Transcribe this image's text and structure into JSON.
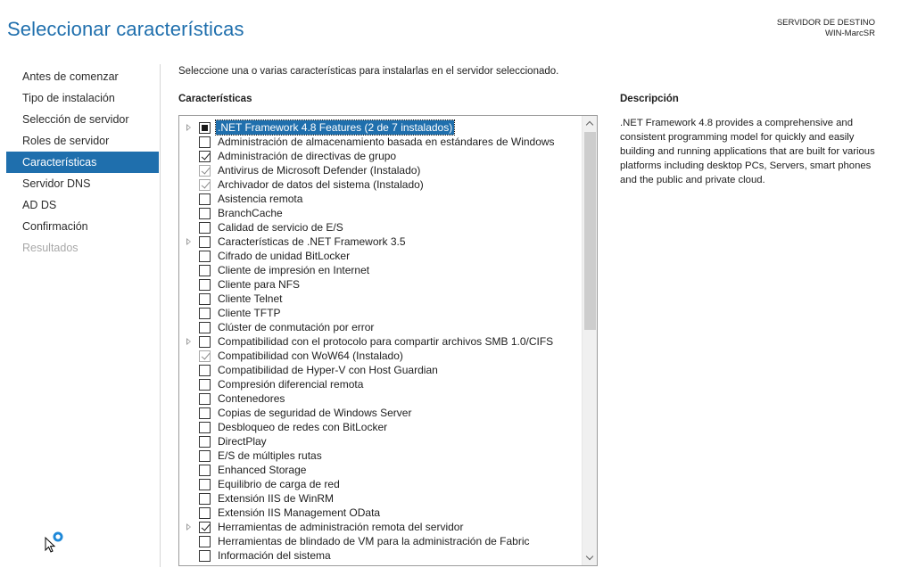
{
  "header": {
    "title": "Seleccionar características",
    "dest_label": "SERVIDOR DE DESTINO",
    "dest_server": "WIN-MarcSR"
  },
  "nav": {
    "items": [
      {
        "label": "Antes de comenzar",
        "state": "normal"
      },
      {
        "label": "Tipo de instalación",
        "state": "normal"
      },
      {
        "label": "Selección de servidor",
        "state": "normal"
      },
      {
        "label": "Roles de servidor",
        "state": "normal"
      },
      {
        "label": "Características",
        "state": "active"
      },
      {
        "label": "Servidor DNS",
        "state": "normal"
      },
      {
        "label": "AD DS",
        "state": "normal"
      },
      {
        "label": "Confirmación",
        "state": "normal"
      },
      {
        "label": "Resultados",
        "state": "disabled"
      }
    ]
  },
  "main": {
    "instruction": "Seleccione una o varias características para instalarlas en el servidor seleccionado.",
    "features_label": "Características",
    "features": [
      {
        "label": ".NET Framework 4.8 Features (2 de 7 instalados)",
        "expander": true,
        "state": "partial",
        "selected": true
      },
      {
        "label": "Administración de almacenamiento basada en estándares de Windows",
        "expander": false,
        "state": "unchecked"
      },
      {
        "label": "Administración de directivas de grupo",
        "expander": false,
        "state": "checked"
      },
      {
        "label": "Antivirus de Microsoft Defender (Instalado)",
        "expander": false,
        "state": "checked-grey"
      },
      {
        "label": "Archivador de datos del sistema (Instalado)",
        "expander": false,
        "state": "checked-grey"
      },
      {
        "label": "Asistencia remota",
        "expander": false,
        "state": "unchecked"
      },
      {
        "label": "BranchCache",
        "expander": false,
        "state": "unchecked"
      },
      {
        "label": "Calidad de servicio de E/S",
        "expander": false,
        "state": "unchecked"
      },
      {
        "label": "Características de .NET Framework 3.5",
        "expander": true,
        "state": "unchecked"
      },
      {
        "label": "Cifrado de unidad BitLocker",
        "expander": false,
        "state": "unchecked"
      },
      {
        "label": "Cliente de impresión en Internet",
        "expander": false,
        "state": "unchecked"
      },
      {
        "label": "Cliente para NFS",
        "expander": false,
        "state": "unchecked"
      },
      {
        "label": "Cliente Telnet",
        "expander": false,
        "state": "unchecked"
      },
      {
        "label": "Cliente TFTP",
        "expander": false,
        "state": "unchecked"
      },
      {
        "label": "Clúster de conmutación por error",
        "expander": false,
        "state": "unchecked"
      },
      {
        "label": "Compatibilidad con el protocolo para compartir archivos SMB 1.0/CIFS",
        "expander": true,
        "state": "unchecked"
      },
      {
        "label": "Compatibilidad con WoW64 (Instalado)",
        "expander": false,
        "state": "checked-grey"
      },
      {
        "label": "Compatibilidad de Hyper-V con Host Guardian",
        "expander": false,
        "state": "unchecked"
      },
      {
        "label": "Compresión diferencial remota",
        "expander": false,
        "state": "unchecked"
      },
      {
        "label": "Contenedores",
        "expander": false,
        "state": "unchecked"
      },
      {
        "label": "Copias de seguridad de Windows Server",
        "expander": false,
        "state": "unchecked"
      },
      {
        "label": "Desbloqueo de redes con BitLocker",
        "expander": false,
        "state": "unchecked"
      },
      {
        "label": "DirectPlay",
        "expander": false,
        "state": "unchecked"
      },
      {
        "label": "E/S de múltiples rutas",
        "expander": false,
        "state": "unchecked"
      },
      {
        "label": "Enhanced Storage",
        "expander": false,
        "state": "unchecked"
      },
      {
        "label": "Equilibrio de carga de red",
        "expander": false,
        "state": "unchecked"
      },
      {
        "label": "Extensión IIS de WinRM",
        "expander": false,
        "state": "unchecked"
      },
      {
        "label": "Extensión IIS Management OData",
        "expander": false,
        "state": "unchecked"
      },
      {
        "label": "Herramientas de administración remota del servidor",
        "expander": true,
        "state": "checked"
      },
      {
        "label": "Herramientas de blindado de VM para la administración de Fabric",
        "expander": false,
        "state": "unchecked"
      },
      {
        "label": "Información del sistema",
        "expander": false,
        "state": "unchecked"
      }
    ]
  },
  "description": {
    "label": "Descripción",
    "text": ".NET Framework 4.8 provides a comprehensive and consistent programming model for quickly and easily building and running applications that are built for various platforms including desktop PCs, Servers, smart phones and the public and private cloud."
  },
  "colors": {
    "accent": "#1f6fad",
    "title": "#1f6fad",
    "disabled_text": "#a8a8a8"
  }
}
